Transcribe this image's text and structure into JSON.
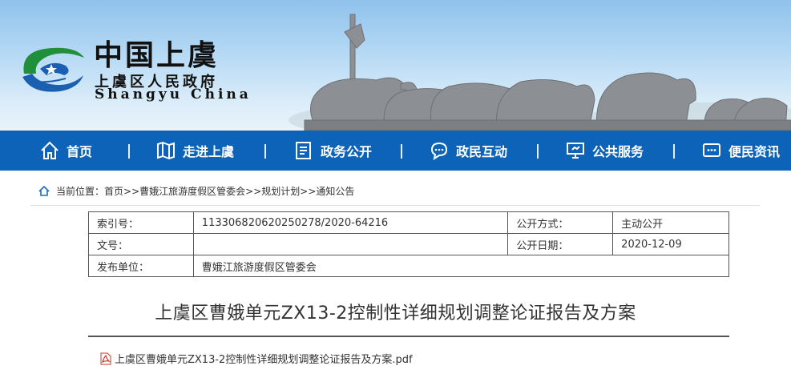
{
  "brand": {
    "title_cn": "中国上虞",
    "subtitle_cn": "上虞区人民政府",
    "subtitle_en": "Shangyu China",
    "logo_colors": [
      "#1f8f3a",
      "#1b5fb0"
    ]
  },
  "nav": {
    "background": "#0c63b8",
    "items": [
      {
        "label": "首页",
        "icon": "home-icon"
      },
      {
        "label": "走进上虞",
        "icon": "map-icon"
      },
      {
        "label": "政务公开",
        "icon": "document-icon"
      },
      {
        "label": "政民互动",
        "icon": "chat-icon"
      },
      {
        "label": "公共服务",
        "icon": "monitor-icon"
      },
      {
        "label": "便民资讯",
        "icon": "message-icon"
      }
    ]
  },
  "breadcrumb": {
    "prefix": "当前位置：",
    "items": [
      "首页",
      "曹娥江旅游度假区管委会",
      "规划计划",
      "通知公告"
    ],
    "separator": ">>"
  },
  "info": {
    "index_label": "索引号：",
    "index_value": "113306820620250278/2020-64216",
    "public_method_label": "公开方式：",
    "public_method_value": "主动公开",
    "doc_no_label": "文号：",
    "doc_no_value": "",
    "public_date_label": "公开日期：",
    "public_date_value": "2020-12-09",
    "publisher_label": "发布单位：",
    "publisher_value": "曹娥江旅游度假区管委会"
  },
  "article": {
    "title": "上虞区曹娥单元ZX13-2控制性详细规划调整论证报告及方案",
    "attachment": "上虞区曹娥单元ZX13-2控制性详细规划调整论证报告及方案.pdf"
  }
}
